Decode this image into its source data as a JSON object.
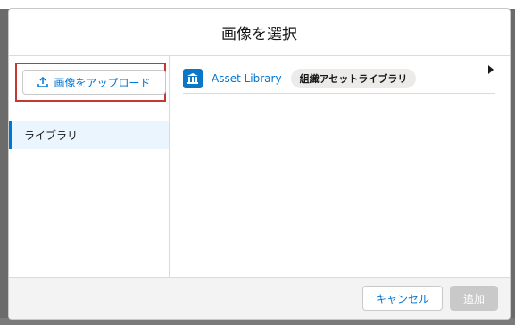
{
  "dialog": {
    "title": "画像を選択"
  },
  "sidebar": {
    "upload_button_label": "画像をアップロード",
    "items": [
      {
        "label": "ライブラリ",
        "selected": true
      }
    ]
  },
  "libraries": [
    {
      "name": "Asset Library",
      "badge": "組織アセットライブラリ",
      "icon": "bank-icon"
    }
  ],
  "footer": {
    "cancel_label": "キャンセル",
    "add_label": "追加"
  },
  "colors": {
    "accent": "#0176d3",
    "highlight_border": "#c23934",
    "selected_bg": "#eaf5fe",
    "library_icon_bg": "#0b77c9",
    "disabled_button": "#c9c9c9"
  }
}
